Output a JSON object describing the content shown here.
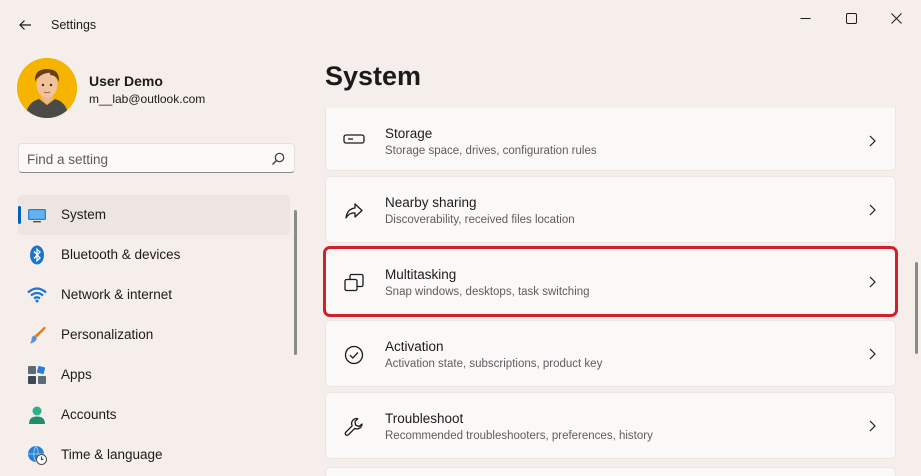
{
  "window": {
    "title": "Settings"
  },
  "profile": {
    "name": "User Demo",
    "email": "m__lab@outlook.com"
  },
  "search": {
    "placeholder": "Find a setting"
  },
  "nav": {
    "items": [
      {
        "label": "System",
        "icon": "monitor-icon",
        "selected": true
      },
      {
        "label": "Bluetooth & devices",
        "icon": "bluetooth-icon"
      },
      {
        "label": "Network & internet",
        "icon": "wifi-icon"
      },
      {
        "label": "Personalization",
        "icon": "brush-icon"
      },
      {
        "label": "Apps",
        "icon": "apps-icon"
      },
      {
        "label": "Accounts",
        "icon": "person-icon"
      },
      {
        "label": "Time & language",
        "icon": "globe-clock-icon"
      }
    ]
  },
  "main": {
    "title": "System",
    "cards": [
      {
        "title": "Storage",
        "subtitle": "Storage space, drives, configuration rules",
        "icon": "storage-drive-icon"
      },
      {
        "title": "Nearby sharing",
        "subtitle": "Discoverability, received files location",
        "icon": "share-icon"
      },
      {
        "title": "Multitasking",
        "subtitle": "Snap windows, desktops, task switching",
        "icon": "multitasking-icon",
        "highlighted": true
      },
      {
        "title": "Activation",
        "subtitle": "Activation state, subscriptions, product key",
        "icon": "check-circle-icon"
      },
      {
        "title": "Troubleshoot",
        "subtitle": "Recommended troubleshooters, preferences, history",
        "icon": "wrench-icon"
      }
    ]
  },
  "colors": {
    "accent": "#005fb8",
    "highlight_border": "#d21f2d",
    "background": "#f6eeea"
  }
}
